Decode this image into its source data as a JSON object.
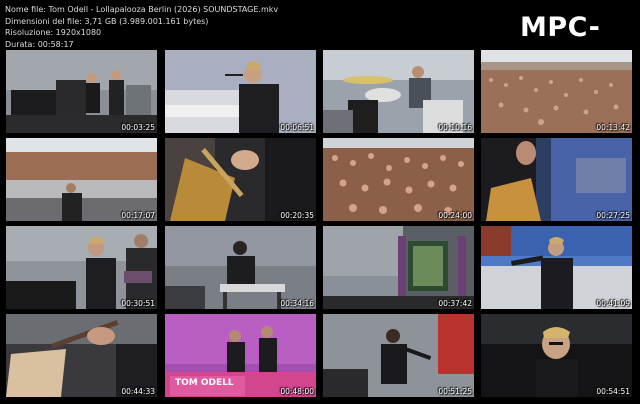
{
  "info": {
    "name": "Nome file: Tom Odell - Lollapalooza Berlin (2026) SOUNDSTAGE.mkv",
    "size": "Dimensioni del file: 3,71 GB (3.989.001.161 bytes)",
    "resolution": "Risoluzione: 1920x1080",
    "duration": "Durata: 00:58:17"
  },
  "logo": "MPC-HC",
  "thumbnails": [
    {
      "time": "00:03:25",
      "scene": "stage-piano-band"
    },
    {
      "time": "00:06:51",
      "scene": "singer-at-piano"
    },
    {
      "time": "00:10:16",
      "scene": "drummer"
    },
    {
      "time": "00:13:42",
      "scene": "crowd-wide"
    },
    {
      "time": "00:17:07",
      "scene": "crowd-barrier"
    },
    {
      "time": "00:20:35",
      "scene": "guitar-closeup"
    },
    {
      "time": "00:24:00",
      "scene": "crowd-dense"
    },
    {
      "time": "00:27:25",
      "scene": "guitarist-blue-stage"
    },
    {
      "time": "00:30:51",
      "scene": "guitarist-and-singer"
    },
    {
      "time": "00:34:16",
      "scene": "keyboard-player"
    },
    {
      "time": "00:37:42",
      "scene": "smoke-stage-screen"
    },
    {
      "time": "00:41:09",
      "scene": "singer-blue-backdrop"
    },
    {
      "time": "00:44:33",
      "scene": "guitar-hands-closeup"
    },
    {
      "time": "00:48:00",
      "scene": "pink-stage-tom-odell"
    },
    {
      "time": "00:51:25",
      "scene": "singer-with-mic-smoke"
    },
    {
      "time": "00:54:51",
      "scene": "singer-closeup-dark"
    }
  ],
  "stage_banner": "TOM ODELL"
}
